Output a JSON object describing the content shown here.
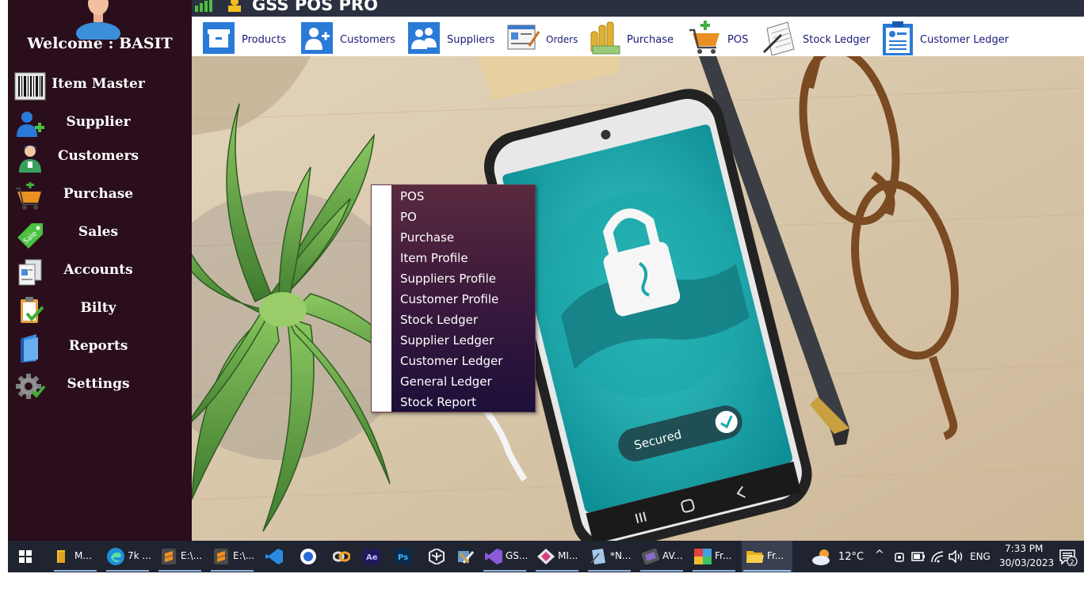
{
  "app": {
    "title": "GSS POS PRO",
    "welcome": "Welcome : BASIT"
  },
  "colors": {
    "sidebar_bg": "#2a0e1c",
    "titlebar_bg": "#2b3040",
    "menu_top": "#5a2a3e",
    "menu_bottom": "#1c103a",
    "toolbar_text": "#1a1a7a",
    "taskbar_bg": "#1f2430"
  },
  "sidebar": {
    "items": [
      {
        "label": "Item Master",
        "icon": "barcode-icon"
      },
      {
        "label": "Supplier",
        "icon": "add-user-icon"
      },
      {
        "label": "Customers",
        "icon": "customer-icon"
      },
      {
        "label": "Purchase",
        "icon": "cart-add-icon"
      },
      {
        "label": "Sales",
        "icon": "sale-tag-icon"
      },
      {
        "label": "Accounts",
        "icon": "documents-icon"
      },
      {
        "label": "Bilty",
        "icon": "clipboard-check-icon"
      },
      {
        "label": "Reports",
        "icon": "folder-icon"
      },
      {
        "label": "Settings",
        "icon": "gear-icon"
      }
    ]
  },
  "toolbar": {
    "buttons": [
      {
        "label": "Products",
        "icon": "box-icon"
      },
      {
        "label": "Customers",
        "icon": "add-customer-icon"
      },
      {
        "label": "Suppliers",
        "icon": "suppliers-icon"
      },
      {
        "label": "Orders",
        "icon": "orders-icon"
      },
      {
        "label": "Purchase",
        "icon": "coins-icon"
      },
      {
        "label": "POS",
        "icon": "cart-icon"
      },
      {
        "label": "Stock Ledger",
        "icon": "notepad-icon"
      },
      {
        "label": "Customer Ledger",
        "icon": "clipboard-icon"
      }
    ]
  },
  "context_menu": {
    "items": [
      "POS",
      "PO",
      "Purchase",
      "Item Profile",
      "Suppliers Profile",
      "Customer Profile",
      "Stock Ledger",
      "Supplier Ledger",
      "Customer Ledger",
      "General Ledger",
      "Stock Report"
    ]
  },
  "background": {
    "phone_badge": "Secured"
  },
  "taskbar": {
    "apps": [
      {
        "label": "M...",
        "icon": "file-explorer-icon"
      },
      {
        "label": "7k ...",
        "icon": "edge-icon"
      },
      {
        "label": "E:\\...",
        "icon": "sublime-icon"
      },
      {
        "label": "E:\\...",
        "icon": "sublime-icon"
      },
      {
        "label": "",
        "icon": "vscode-icon"
      },
      {
        "label": "",
        "icon": "app-icon"
      },
      {
        "label": "",
        "icon": "link-icon"
      },
      {
        "label": "",
        "icon": "after-effects-icon"
      },
      {
        "label": "",
        "icon": "photoshop-icon"
      },
      {
        "label": "",
        "icon": "unity-icon"
      },
      {
        "label": "",
        "icon": "tools-icon"
      },
      {
        "label": "GS...",
        "icon": "visual-studio-icon"
      },
      {
        "label": "MI...",
        "icon": "diamond-icon"
      },
      {
        "label": "*N...",
        "icon": "notepad-icon"
      },
      {
        "label": "AV...",
        "icon": "film-icon"
      },
      {
        "label": "Fr...",
        "icon": "image-icon"
      },
      {
        "label": "Fr...",
        "icon": "folder-open-icon"
      }
    ],
    "weather": "12°C",
    "language": "ENG",
    "time": "7:33 PM",
    "date": "30/03/2023",
    "notifications": "2"
  }
}
